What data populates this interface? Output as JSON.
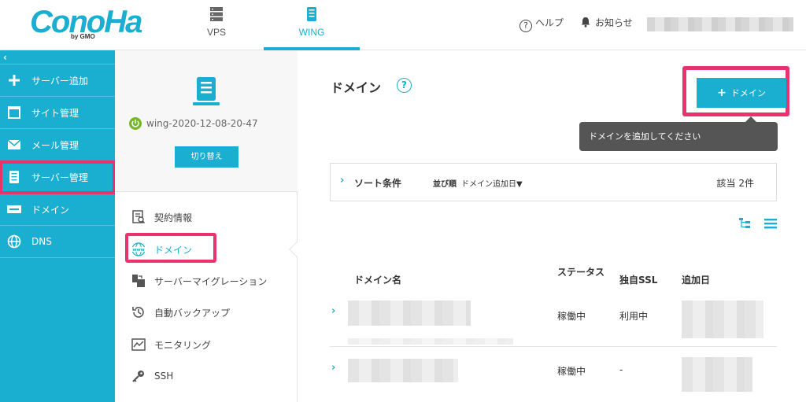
{
  "topbar": {
    "logo_text": "ConoHa",
    "logo_sub": "by GMO",
    "tabs": [
      {
        "label": "VPS"
      },
      {
        "label": "WING"
      }
    ],
    "help_label": "ヘルプ",
    "help_glyph": "?",
    "notice_label": "お知らせ"
  },
  "left_nav": {
    "collapse_glyph": "‹",
    "items": [
      {
        "label": "サーバー追加",
        "icon": "plus-icon"
      },
      {
        "label": "サイト管理",
        "icon": "window-icon"
      },
      {
        "label": "メール管理",
        "icon": "mail-icon"
      },
      {
        "label": "サーバー管理",
        "icon": "server-icon"
      },
      {
        "label": "ドメイン",
        "icon": "domain-icon"
      },
      {
        "label": "DNS",
        "icon": "globe-icon"
      }
    ]
  },
  "server_panel": {
    "server_name": "wing-2020-12-08-20-47",
    "switch_label": "切り替え",
    "items": [
      {
        "label": "契約情報",
        "icon": "contract-icon"
      },
      {
        "label": "ドメイン",
        "icon": "www-icon"
      },
      {
        "label": "サーバーマイグレーション",
        "icon": "migration-icon"
      },
      {
        "label": "自動バックアップ",
        "icon": "backup-icon"
      },
      {
        "label": "モニタリング",
        "icon": "monitoring-icon"
      },
      {
        "label": "SSH",
        "icon": "key-icon"
      }
    ]
  },
  "main": {
    "title": "ドメイン",
    "help_glyph": "?",
    "add_button": "ドメイン",
    "add_glyph": "+",
    "tooltip": "ドメインを追加してください",
    "sort": {
      "chevron": "›",
      "title": "ソート条件",
      "order_label": "並び順",
      "order_value": "ドメイン追加日▼",
      "count_text": "該当 2件"
    },
    "table": {
      "headers": {
        "name": "ドメイン名",
        "status": "ステータス",
        "ssl": "独自SSL",
        "added": "追加日"
      },
      "rows": [
        {
          "chevron": "›",
          "status": "稼働中",
          "ssl": "利用中"
        },
        {
          "chevron": "›",
          "status": "稼働中",
          "ssl": "-"
        }
      ]
    }
  },
  "colors": {
    "accent": "#1aaed1",
    "highlight": "#e8336e",
    "power": "#76b82a"
  }
}
